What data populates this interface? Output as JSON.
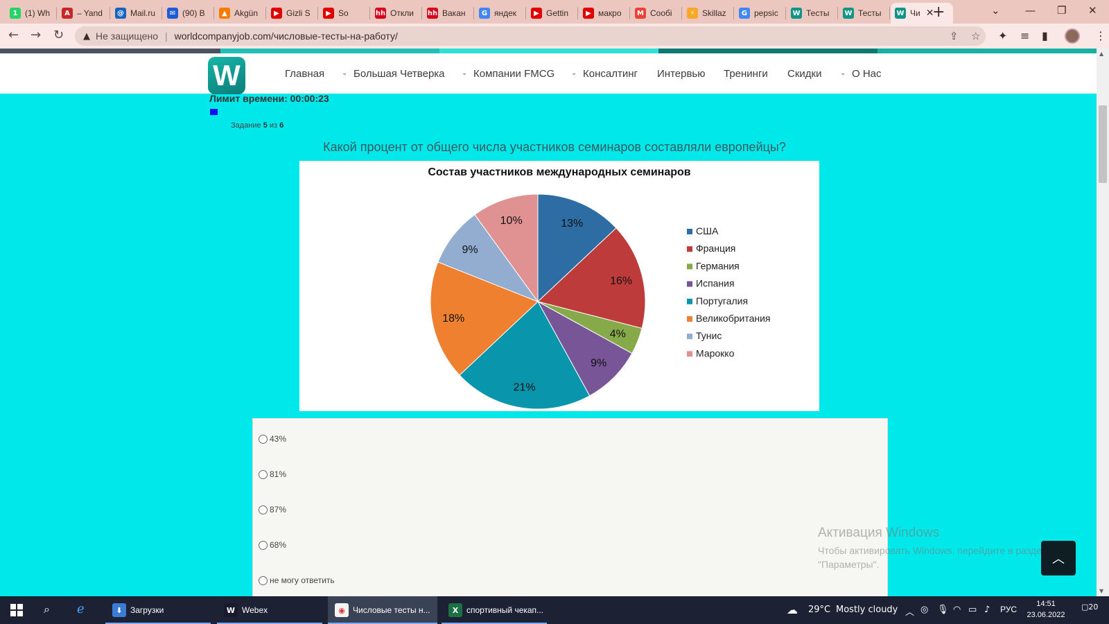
{
  "browser": {
    "tabs": [
      {
        "label": "(1) Wh",
        "fav_color": "#25d366",
        "fav_char": "1"
      },
      {
        "label": "– Yand",
        "fav_color": "#c62828",
        "fav_char": "A"
      },
      {
        "label": "Mail.ru",
        "fav_color": "#1565c0",
        "fav_char": "@"
      },
      {
        "label": "(90) B",
        "fav_color": "#1e5bd8",
        "fav_char": "✉"
      },
      {
        "label": "Akgün",
        "fav_color": "#f57c00",
        "fav_char": "▲"
      },
      {
        "label": "Gizli S",
        "fav_color": "#e00000",
        "fav_char": "▶"
      },
      {
        "label": "So",
        "fav_color": "#e00000",
        "fav_char": "▶"
      },
      {
        "label": "Откли",
        "fav_color": "#d6001c",
        "fav_char": "hh"
      },
      {
        "label": "Вакан",
        "fav_color": "#d6001c",
        "fav_char": "hh"
      },
      {
        "label": "яндек",
        "fav_color": "#4285f4",
        "fav_char": "G"
      },
      {
        "label": "Gettin",
        "fav_color": "#e00000",
        "fav_char": "▶"
      },
      {
        "label": "макро",
        "fav_color": "#e00000",
        "fav_char": "▶"
      },
      {
        "label": "Сообі",
        "fav_color": "#ea4335",
        "fav_char": "M"
      },
      {
        "label": "Skillaz",
        "fav_color": "#f9a825",
        "fav_char": "⚡"
      },
      {
        "label": "pepsic",
        "fav_color": "#4285f4",
        "fav_char": "G"
      },
      {
        "label": "Тесты",
        "fav_color": "#0f9488",
        "fav_char": "W"
      },
      {
        "label": "Тесты",
        "fav_color": "#0f9488",
        "fav_char": "W"
      },
      {
        "label": "Чи",
        "fav_color": "#0f9488",
        "fav_char": "W"
      }
    ],
    "security_label": "Не защищено",
    "url": "worldcompanyjob.com/числовые-тесты-на-работу/"
  },
  "site": {
    "logo_letter": "W",
    "nav": [
      {
        "label": "Главная",
        "caret": false
      },
      {
        "label": "Большая Четверка",
        "caret": true
      },
      {
        "label": "Компании FMCG",
        "caret": true
      },
      {
        "label": "Консалтинг",
        "caret": true
      },
      {
        "label": "Интервью",
        "caret": false
      },
      {
        "label": "Тренинги",
        "caret": false
      },
      {
        "label": "Скидки",
        "caret": false
      },
      {
        "label": "О Нас",
        "caret": true
      }
    ]
  },
  "quiz": {
    "time_limit": "Лимит времени: 00:00:23",
    "time_remaining_fraction": 0.14,
    "task_prefix": "Задание",
    "task_current": "5",
    "task_of": "из",
    "task_total": "6",
    "question": "Какой процент от общего числа участников семинаров составляли европейцы?",
    "options": [
      "43%",
      "81%",
      "87%",
      "68%",
      "не могу ответить"
    ]
  },
  "chart_data": {
    "type": "pie",
    "title": "Состав участников международных семинаров",
    "legend_position": "right",
    "slices": [
      {
        "label": "США",
        "value": 13,
        "color": "#2e6da4"
      },
      {
        "label": "Франция",
        "value": 16,
        "color": "#be3b3b"
      },
      {
        "label": "Германия",
        "value": 4,
        "color": "#86aa4a"
      },
      {
        "label": "Испания",
        "value": 9,
        "color": "#775597"
      },
      {
        "label": "Португалия",
        "value": 21,
        "color": "#0995ab"
      },
      {
        "label": "Великобритания",
        "value": 18,
        "color": "#ee8030"
      },
      {
        "label": "Тунис",
        "value": 9,
        "color": "#92add0"
      },
      {
        "label": "Марокко",
        "value": 10,
        "color": "#e09292"
      }
    ],
    "value_suffix": "%"
  },
  "windows_watermark": {
    "line1": "Активация Windows",
    "line2": "Чтобы активировать Windows, перейдите в раздел",
    "line3": "\"Параметры\"."
  },
  "taskbar": {
    "apps": [
      {
        "label": "Загрузки",
        "icon_color": "#3a7bd5",
        "icon_char": "⬇"
      },
      {
        "label": "Webex",
        "icon_color": "#1a1a2e",
        "icon_char": "W"
      },
      {
        "label": "Числовые тесты н...",
        "icon_color": "#f4f4f4",
        "icon_char": "◉"
      },
      {
        "label": "спортивный чекап...",
        "icon_color": "#1d7044",
        "icon_char": "X"
      }
    ],
    "weather_temp": "29°C",
    "weather_text": "Mostly cloudy",
    "language": "РУС",
    "time": "14:51",
    "date": "23.06.2022",
    "notifications": "20"
  }
}
